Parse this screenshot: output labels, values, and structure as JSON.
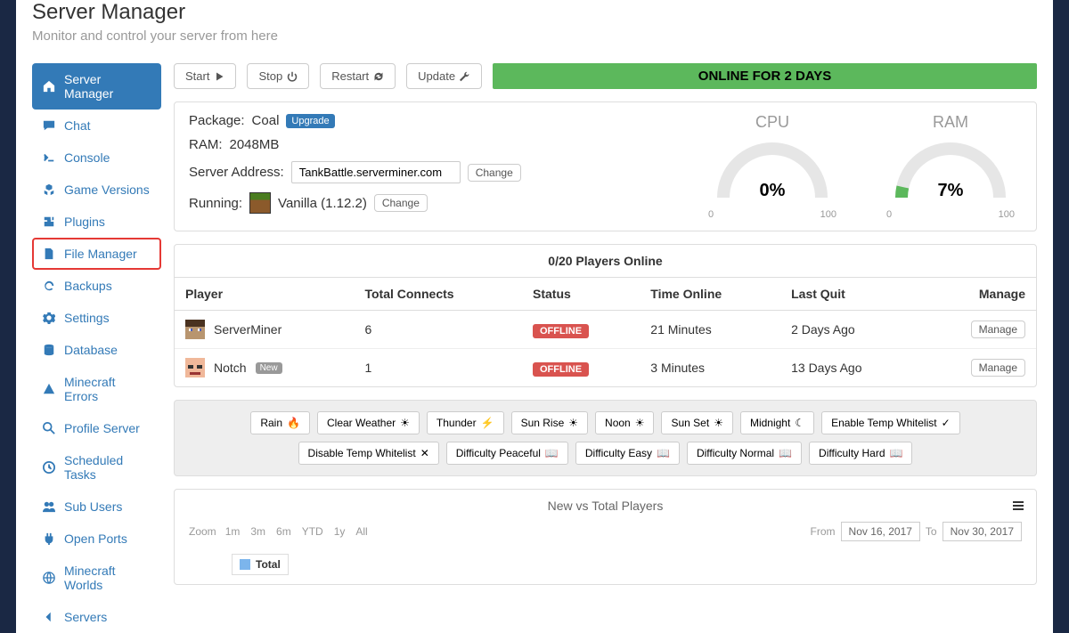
{
  "page": {
    "title": "Server Manager",
    "subtitle": "Monitor and control your server from here"
  },
  "sidebar": {
    "items": [
      {
        "label": "Server Manager",
        "icon": "home"
      },
      {
        "label": "Chat",
        "icon": "comment"
      },
      {
        "label": "Console",
        "icon": "terminal"
      },
      {
        "label": "Game Versions",
        "icon": "cubes"
      },
      {
        "label": "Plugins",
        "icon": "puzzle"
      },
      {
        "label": "File Manager",
        "icon": "file"
      },
      {
        "label": "Backups",
        "icon": "refresh"
      },
      {
        "label": "Settings",
        "icon": "gear"
      },
      {
        "label": "Database",
        "icon": "database"
      },
      {
        "label": "Minecraft Errors",
        "icon": "warning"
      },
      {
        "label": "Profile Server",
        "icon": "search"
      },
      {
        "label": "Scheduled Tasks",
        "icon": "clock"
      },
      {
        "label": "Sub Users",
        "icon": "users"
      },
      {
        "label": "Open Ports",
        "icon": "plug"
      },
      {
        "label": "Minecraft Worlds",
        "icon": "globe"
      },
      {
        "label": "Servers",
        "icon": "chevron-left"
      }
    ]
  },
  "toolbar": {
    "start": "Start",
    "stop": "Stop",
    "restart": "Restart",
    "update": "Update"
  },
  "status": {
    "text": "ONLINE FOR 2 DAYS"
  },
  "info": {
    "package_label": "Package:",
    "package_value": "Coal",
    "upgrade": "Upgrade",
    "ram_label": "RAM:",
    "ram_value": "2048MB",
    "addr_label": "Server Address:",
    "addr_value": "TankBattle.serverminer.com",
    "change": "Change",
    "running_label": "Running:",
    "running_value": "Vanilla (1.12.2)"
  },
  "gauges": {
    "cpu": {
      "title": "CPU",
      "value": "0%",
      "min": "0",
      "max": "100",
      "pct": 0
    },
    "ram": {
      "title": "RAM",
      "value": "7%",
      "min": "0",
      "max": "100",
      "pct": 7
    }
  },
  "players": {
    "header": "0/20 Players Online",
    "cols": {
      "player": "Player",
      "connects": "Total Connects",
      "status": "Status",
      "time": "Time Online",
      "lastquit": "Last Quit",
      "manage": "Manage"
    },
    "rows": [
      {
        "name": "ServerMiner",
        "connects": "6",
        "status": "OFFLINE",
        "time": "21 Minutes",
        "lastquit": "2 Days Ago",
        "new": false
      },
      {
        "name": "Notch",
        "connects": "1",
        "status": "OFFLINE",
        "time": "3 Minutes",
        "lastquit": "13 Days Ago",
        "new": true
      }
    ],
    "new_badge": "New",
    "manage_btn": "Manage"
  },
  "quick_actions": [
    "Rain",
    "Clear Weather",
    "Thunder",
    "Sun Rise",
    "Noon",
    "Sun Set",
    "Midnight",
    "Enable Temp Whitelist",
    "Disable Temp Whitelist",
    "Difficulty Peaceful",
    "Difficulty Easy",
    "Difficulty Normal",
    "Difficulty Hard"
  ],
  "chart": {
    "title": "New vs Total Players",
    "zoom_label": "Zoom",
    "zoom_options": [
      "1m",
      "3m",
      "6m",
      "YTD",
      "1y",
      "All"
    ],
    "from_label": "From",
    "from_value": "Nov 16, 2017",
    "to_label": "To",
    "to_value": "Nov 30, 2017",
    "legend_total": "Total"
  },
  "chart_data": {
    "type": "line",
    "title": "New vs Total Players",
    "xlabel": "",
    "ylabel": "",
    "x_range": [
      "2017-11-16",
      "2017-11-30"
    ],
    "series": [
      {
        "name": "Total",
        "values": []
      }
    ]
  }
}
